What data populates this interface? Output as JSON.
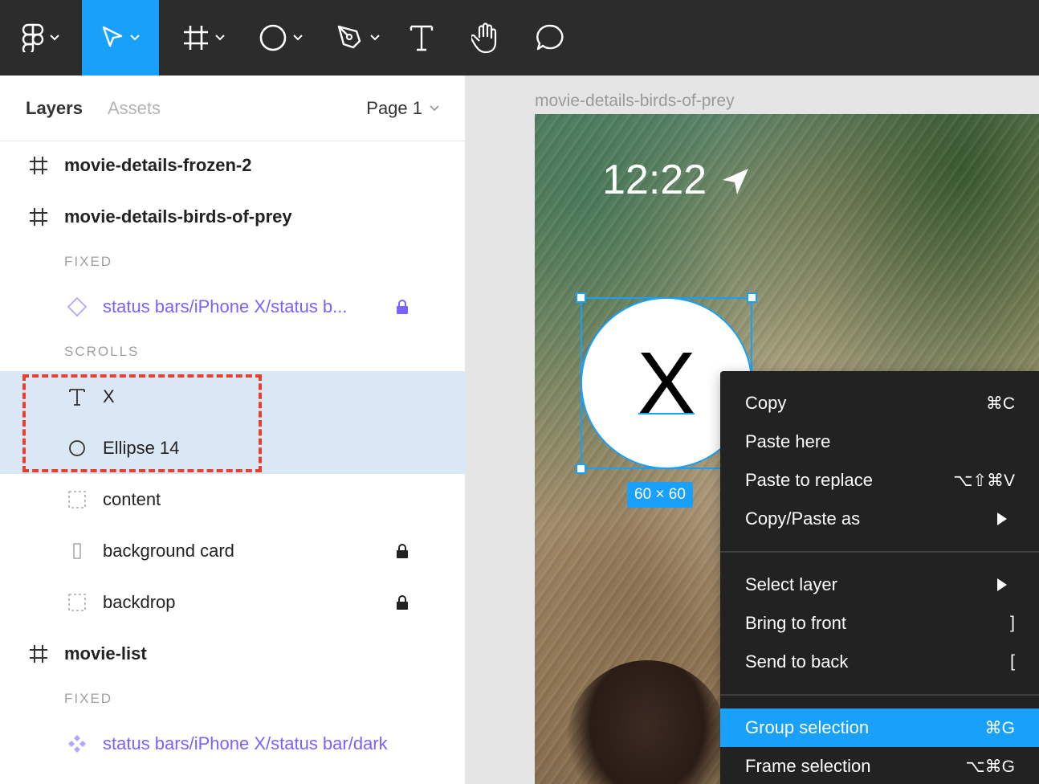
{
  "toolbar": {
    "tools": [
      {
        "name": "figma-menu",
        "active": false
      },
      {
        "name": "move-tool",
        "active": true
      },
      {
        "name": "frame-tool",
        "active": false
      },
      {
        "name": "shape-tool",
        "active": false
      },
      {
        "name": "pen-tool",
        "active": false
      },
      {
        "name": "text-tool",
        "active": false
      },
      {
        "name": "hand-tool",
        "active": false
      },
      {
        "name": "comment-tool",
        "active": false
      }
    ],
    "accent": "#18a0fb"
  },
  "panel": {
    "tabs": {
      "layers": "Layers",
      "assets": "Assets"
    },
    "page": "Page 1",
    "layers": {
      "frame1": "movie-details-frozen-2",
      "frame2": "movie-details-birds-of-prey",
      "fixed1": "FIXED",
      "status1": "status bars/iPhone X/status b...",
      "scrolls": "SCROLLS",
      "x": "X",
      "ellipse": "Ellipse 14",
      "content": "content",
      "bgcard": "background card",
      "backdrop": "backdrop",
      "frame3": "movie-list",
      "fixed2": "FIXED",
      "status2": "status bars/iPhone X/status bar/dark"
    },
    "selection_color": "#dae7f5",
    "component_color": "#7b61ff",
    "annotation_color": "#e8402f"
  },
  "canvas": {
    "frame_title": "movie-details-birds-of-prey",
    "time": "12:22",
    "circle_text": "X",
    "size_badge": "60 × 60"
  },
  "context_menu": {
    "items": {
      "copy": {
        "label": "Copy",
        "shortcut": "⌘C"
      },
      "paste_here": {
        "label": "Paste here",
        "shortcut": ""
      },
      "paste_replace": {
        "label": "Paste to replace",
        "shortcut": "⌥⇧⌘V"
      },
      "copy_paste_as": {
        "label": "Copy/Paste as",
        "shortcut": ""
      },
      "select_layer": {
        "label": "Select layer",
        "shortcut": ""
      },
      "bring_front": {
        "label": "Bring to front",
        "shortcut": "]"
      },
      "send_back": {
        "label": "Send to back",
        "shortcut": "["
      },
      "group": {
        "label": "Group selection",
        "shortcut": "⌘G"
      },
      "frame": {
        "label": "Frame selection",
        "shortcut": "⌥⌘G"
      }
    },
    "highlighted": "Group selection"
  }
}
